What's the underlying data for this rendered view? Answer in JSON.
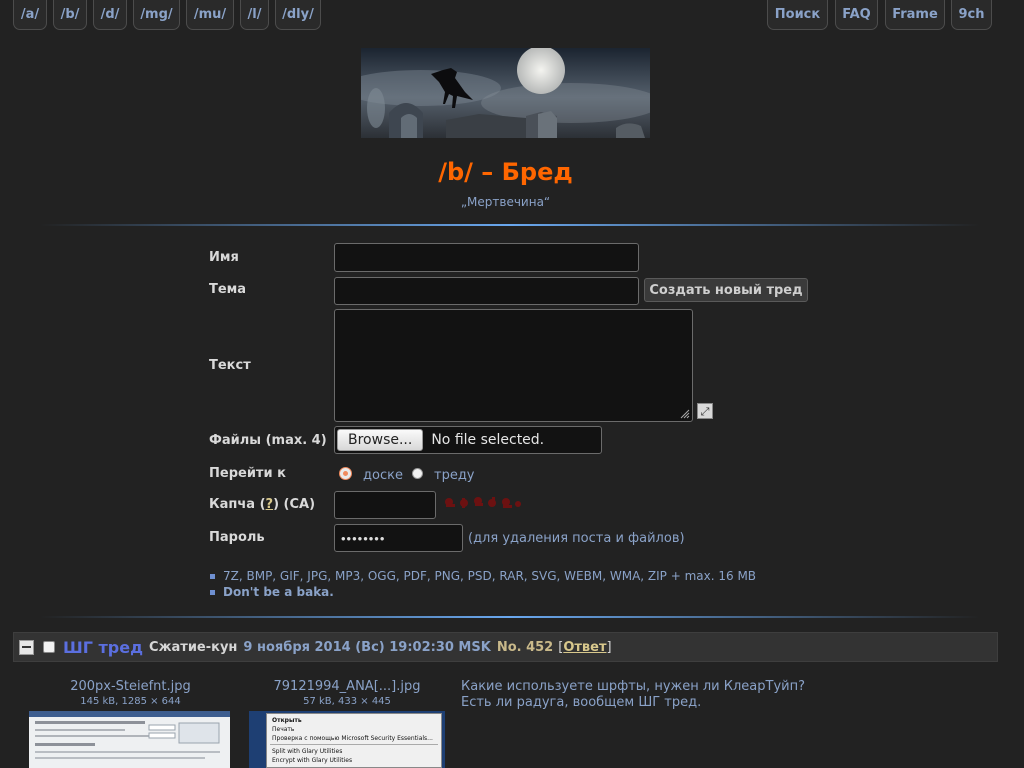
{
  "nav": {
    "left": [
      {
        "label": "/a/"
      },
      {
        "label": "/b/"
      },
      {
        "label": "/d/"
      },
      {
        "label": "/mg/"
      },
      {
        "label": "/mu/"
      },
      {
        "label": "/l/"
      },
      {
        "label": "/dly/"
      }
    ],
    "right": [
      {
        "label": "Поиск"
      },
      {
        "label": "FAQ"
      },
      {
        "label": "Frame"
      },
      {
        "label": "9ch"
      }
    ]
  },
  "board": {
    "title": "/b/ – Бред",
    "subtitle": "„Мертвечина“"
  },
  "form": {
    "name_label": "Имя",
    "name_value": "",
    "subject_label": "Тема",
    "subject_value": "",
    "create_button": "Создать новый тред",
    "text_label": "Текст",
    "text_value": "",
    "files_label": "Файлы (max. 4)",
    "browse_button": "Browse...",
    "no_file": "No file selected.",
    "goto_label": "Перейти к",
    "goto_options": [
      "доске",
      "треду"
    ],
    "goto_selected": "доске",
    "captcha_label_prefix": "Капча (",
    "captcha_help": "?",
    "captcha_label_suffix": ") (CA)",
    "captcha_value": "",
    "password_label": "Пароль",
    "password_value": "••••••••",
    "password_hint": "(для удаления поста и файлов)",
    "rules": [
      "7Z, BMP, GIF, JPG, MP3, OGG, PDF, PNG, PSD, RAR, SVG, WEBM, WMA, ZIP + max. 16 MB",
      "Don't be a baka."
    ]
  },
  "thread": {
    "title": "ШГ тред",
    "author": "Сжатие-кун",
    "date": "9 ноября 2014 (Вс) 19:02:30 MSK",
    "number": "No. 452",
    "reply_open": "[",
    "reply_label": "Ответ",
    "reply_close": "]",
    "files": [
      {
        "name": "200px-Steiefnt.jpg",
        "meta": "145 kB, 1285 × 644"
      },
      {
        "name": "79121994_ANA[...].jpg",
        "meta": "57 kB, 433 × 445"
      }
    ],
    "menu_items": [
      "Открыть",
      "Печать",
      "Проверка с помощью Microsoft Security Essentials...",
      "Split with Glary Utilities",
      "Encrypt with Glary Utilities"
    ],
    "text_lines": [
      "Какие используете шрфты, нужен ли КлеарТуйп?",
      "Есть ли радуга, вообщем ШГ тред."
    ]
  },
  "colors": {
    "background": "#222222",
    "accent_title": "#ff6600",
    "link": "#8aa2c8",
    "thread_title": "#5b6fe0",
    "number": "#c9b98a",
    "reply": "#d8c88c"
  }
}
